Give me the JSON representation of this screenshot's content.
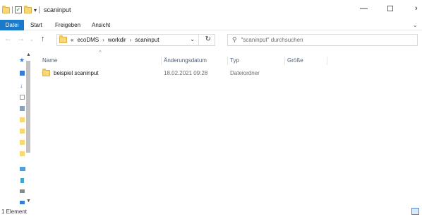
{
  "window": {
    "title": "scaninput",
    "controls": {
      "minimize": "—",
      "maximize": "☐",
      "close": "›"
    }
  },
  "ribbon": {
    "tabs": [
      "Datei",
      "Start",
      "Freigeben",
      "Ansicht"
    ]
  },
  "address": {
    "overflow": "«",
    "crumbs": [
      "ecoDMS",
      "workdir",
      "scaninput"
    ],
    "separator": "›"
  },
  "search": {
    "placeholder": "\"scaninput\" durchsuchen"
  },
  "columns": [
    "Name",
    "Änderungsdatum",
    "Typ",
    "Größe"
  ],
  "files": [
    {
      "name": "beispiel scaninput",
      "date": "18.02.2021 09:28",
      "type": "Dateiordner",
      "size": ""
    }
  ],
  "status": {
    "count": "1 Element"
  },
  "colors": {
    "accent": "#1979ca",
    "folder": "#f8d775",
    "header_text": "#4c607a"
  }
}
